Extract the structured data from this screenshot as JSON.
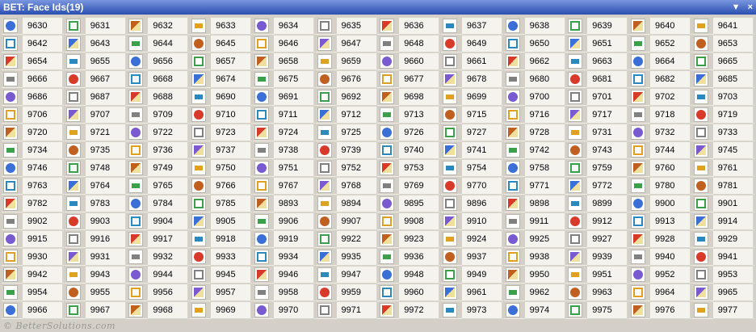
{
  "window": {
    "title": "BET: Face Ids(19)",
    "dropdown_glyph": "▼",
    "close_glyph": "×"
  },
  "grid": {
    "rows": [
      [
        "9630",
        "9631",
        "9632",
        "9633",
        "9634",
        "9635",
        "9636",
        "9637",
        "9638",
        "9639",
        "9640",
        "9641"
      ],
      [
        "9642",
        "9643",
        "9644",
        "9645",
        "9646",
        "9647",
        "9648",
        "9649",
        "9650",
        "9651",
        "9652",
        "9653"
      ],
      [
        "9654",
        "9655",
        "9656",
        "9657",
        "9658",
        "9659",
        "9660",
        "9661",
        "9662",
        "9663",
        "9664",
        "9665"
      ],
      [
        "9666",
        "9667",
        "9668",
        "9674",
        "9675",
        "9676",
        "9677",
        "9678",
        "9680",
        "9681",
        "9682",
        "9685"
      ],
      [
        "9686",
        "9687",
        "9688",
        "9690",
        "9691",
        "9692",
        "9698",
        "9699",
        "9700",
        "9701",
        "9702",
        "9703"
      ],
      [
        "9706",
        "9707",
        "9709",
        "9710",
        "9711",
        "9712",
        "9713",
        "9715",
        "9716",
        "9717",
        "9718",
        "9719"
      ],
      [
        "9720",
        "9721",
        "9722",
        "9723",
        "9724",
        "9725",
        "9726",
        "9727",
        "9728",
        "9731",
        "9732",
        "9733"
      ],
      [
        "9734",
        "9735",
        "9736",
        "9737",
        "9738",
        "9739",
        "9740",
        "9741",
        "9742",
        "9743",
        "9744",
        "9745"
      ],
      [
        "9746",
        "9748",
        "9749",
        "9750",
        "9751",
        "9752",
        "9753",
        "9754",
        "9758",
        "9759",
        "9760",
        "9761"
      ],
      [
        "9763",
        "9764",
        "9765",
        "9766",
        "9767",
        "9768",
        "9769",
        "9770",
        "9771",
        "9772",
        "9780",
        "9781"
      ],
      [
        "9782",
        "9783",
        "9784",
        "9785",
        "9893",
        "9894",
        "9895",
        "9896",
        "9898",
        "9899",
        "9900",
        "9901"
      ],
      [
        "9902",
        "9903",
        "9904",
        "9905",
        "9906",
        "9907",
        "9908",
        "9910",
        "9911",
        "9912",
        "9913",
        "9914"
      ],
      [
        "9915",
        "9916",
        "9917",
        "9918",
        "9919",
        "9922",
        "9923",
        "9924",
        "9925",
        "9927",
        "9928",
        "9929"
      ],
      [
        "9930",
        "9931",
        "9932",
        "9933",
        "9934",
        "9935",
        "9936",
        "9937",
        "9938",
        "9939",
        "9940",
        "9941"
      ],
      [
        "9942",
        "9943",
        "9944",
        "9945",
        "9946",
        "9947",
        "9948",
        "9949",
        "9950",
        "9951",
        "9952",
        "9953"
      ],
      [
        "9954",
        "9955",
        "9956",
        "9957",
        "9958",
        "9959",
        "9960",
        "9961",
        "9962",
        "9963",
        "9964",
        "9965"
      ],
      [
        "9966",
        "9967",
        "9968",
        "9969",
        "9970",
        "9971",
        "9972",
        "9973",
        "9974",
        "9975",
        "9976",
        "9977"
      ]
    ],
    "icon_colors": [
      "#3a6fd8",
      "#e0a020",
      "#d83a2a",
      "#3aa04a",
      "#7a5ad0",
      "#2a8ac0",
      "#c06020",
      "#808080"
    ]
  },
  "footer": {
    "text": "© BetterSolutions.com"
  }
}
